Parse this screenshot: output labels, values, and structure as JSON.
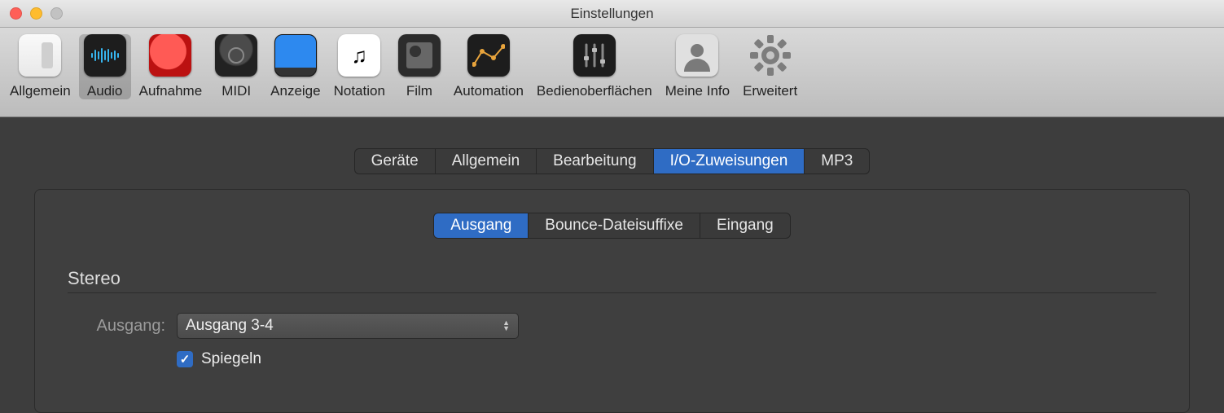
{
  "window": {
    "title": "Einstellungen"
  },
  "toolbar": {
    "items": [
      {
        "label": "Allgemein"
      },
      {
        "label": "Audio"
      },
      {
        "label": "Aufnahme"
      },
      {
        "label": "MIDI"
      },
      {
        "label": "Anzeige"
      },
      {
        "label": "Notation"
      },
      {
        "label": "Film"
      },
      {
        "label": "Automation"
      },
      {
        "label": "Bedienoberflächen"
      },
      {
        "label": "Meine Info"
      },
      {
        "label": "Erweitert"
      }
    ],
    "selected_index": 1
  },
  "tabs_main": {
    "items": [
      "Geräte",
      "Allgemein",
      "Bearbeitung",
      "I/O-Zuweisungen",
      "MP3"
    ],
    "selected_index": 3
  },
  "tabs_sub": {
    "items": [
      "Ausgang",
      "Bounce-Dateisuffixe",
      "Eingang"
    ],
    "selected_index": 0
  },
  "section": {
    "title": "Stereo",
    "rows": {
      "output": {
        "label": "Ausgang:",
        "value": "Ausgang 3-4"
      },
      "mirror": {
        "checked": true,
        "label": "Spiegeln"
      }
    }
  }
}
